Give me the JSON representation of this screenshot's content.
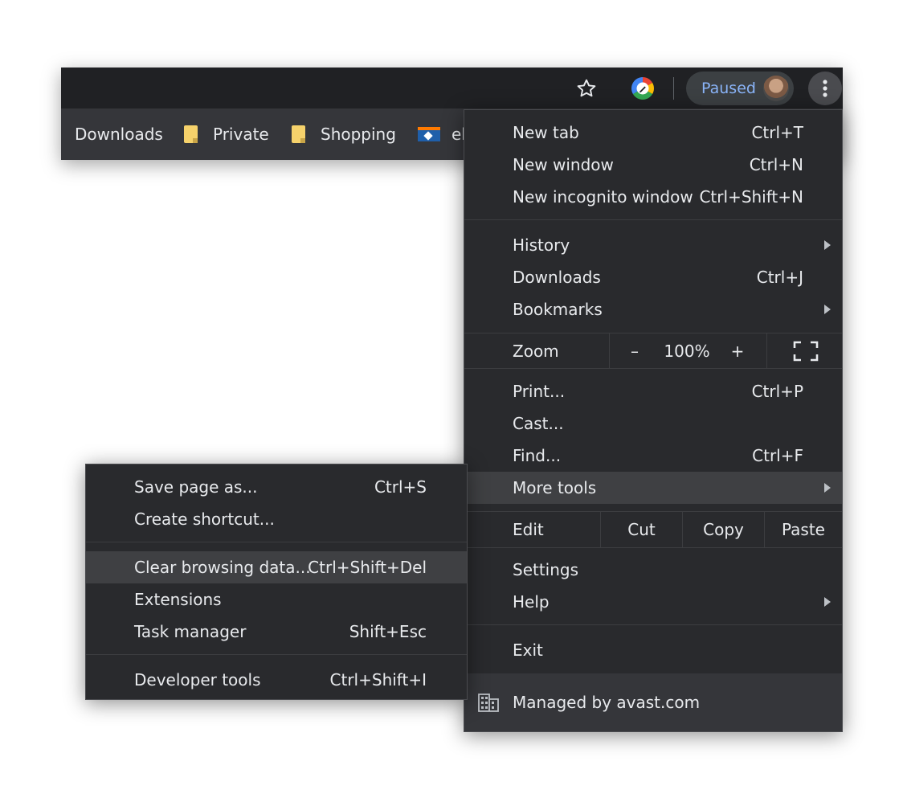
{
  "toolbar": {
    "profile_label": "Paused",
    "icons": [
      "star-icon",
      "extension-icon",
      "avatar",
      "more-vert-icon"
    ]
  },
  "bookmarks": [
    {
      "label": "Downloads",
      "icon": ""
    },
    {
      "label": "Private",
      "icon": "folder-icon"
    },
    {
      "label": "Shopping",
      "icon": "folder-icon"
    },
    {
      "label": "el",
      "icon": "bank-favicon"
    }
  ],
  "main_menu": {
    "new_tab": {
      "label": "New tab",
      "shortcut": "Ctrl+T"
    },
    "new_window": {
      "label": "New window",
      "shortcut": "Ctrl+N"
    },
    "incognito": {
      "label": "New incognito window",
      "shortcut": "Ctrl+Shift+N"
    },
    "history": {
      "label": "History"
    },
    "downloads": {
      "label": "Downloads",
      "shortcut": "Ctrl+J"
    },
    "bookmarks": {
      "label": "Bookmarks"
    },
    "zoom": {
      "label": "Zoom",
      "minus": "–",
      "value": "100%",
      "plus": "+"
    },
    "print": {
      "label": "Print...",
      "shortcut": "Ctrl+P"
    },
    "cast": {
      "label": "Cast..."
    },
    "find": {
      "label": "Find...",
      "shortcut": "Ctrl+F"
    },
    "more_tools": {
      "label": "More tools"
    },
    "edit": {
      "label": "Edit",
      "cut": "Cut",
      "copy": "Copy",
      "paste": "Paste"
    },
    "settings": {
      "label": "Settings"
    },
    "help": {
      "label": "Help"
    },
    "exit": {
      "label": "Exit"
    },
    "managed": {
      "label": "Managed by avast.com"
    }
  },
  "sub_menu": {
    "save_page": {
      "label": "Save page as...",
      "shortcut": "Ctrl+S"
    },
    "create_shortcut": {
      "label": "Create shortcut..."
    },
    "clear_data": {
      "label": "Clear browsing data...",
      "shortcut": "Ctrl+Shift+Del"
    },
    "extensions": {
      "label": "Extensions"
    },
    "task_manager": {
      "label": "Task manager",
      "shortcut": "Shift+Esc"
    },
    "dev_tools": {
      "label": "Developer tools",
      "shortcut": "Ctrl+Shift+I"
    }
  },
  "colors": {
    "menu_bg": "#292a2d",
    "highlight": "#3f4043",
    "text": "#e8eaed",
    "accent": "#8ab4f8"
  }
}
